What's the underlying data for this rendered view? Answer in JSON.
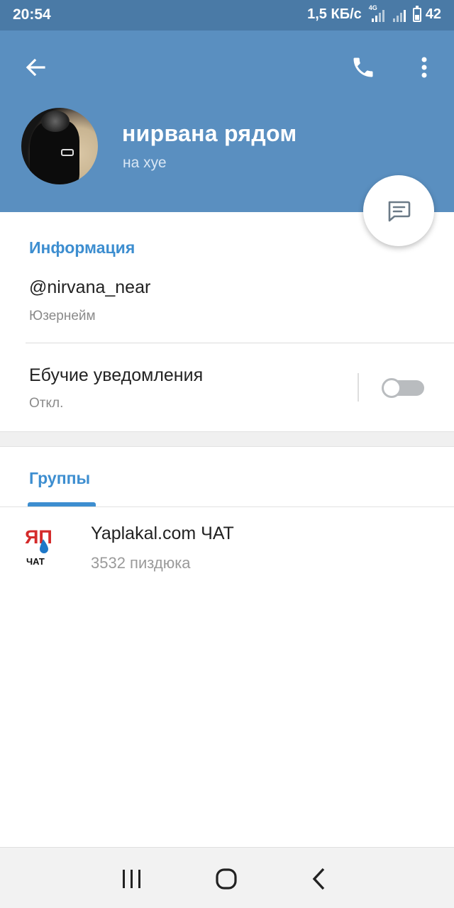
{
  "status_bar": {
    "time": "20:54",
    "net_speed": "1,5 КБ/с",
    "network_tag": "4G",
    "battery": "42"
  },
  "header": {
    "back_icon": "arrow-left-icon",
    "call_icon": "phone-icon",
    "menu_icon": "more-vertical-icon",
    "name": "нирвана рядом",
    "status": "на хуе",
    "fab_icon": "message-icon",
    "color": "#5a8fc0"
  },
  "info": {
    "title": "Информация",
    "username": "@nirvana_near",
    "username_label": "Юзернейм",
    "notifications_label": "Ебучие уведомления",
    "notifications_state": "Откл.",
    "notifications_enabled": false
  },
  "groups": {
    "title": "Группы",
    "items": [
      {
        "logo_text": "ЯП",
        "logo_subtext": "ЧАТ",
        "name": "Yaplakal.com ЧАТ",
        "members": "3532 пиздюка"
      }
    ]
  },
  "nav_bar": {
    "recents_icon": "recents-icon",
    "home_icon": "home-icon",
    "back_icon": "back-chevron-icon"
  },
  "accent_color": "#3d8ed0"
}
